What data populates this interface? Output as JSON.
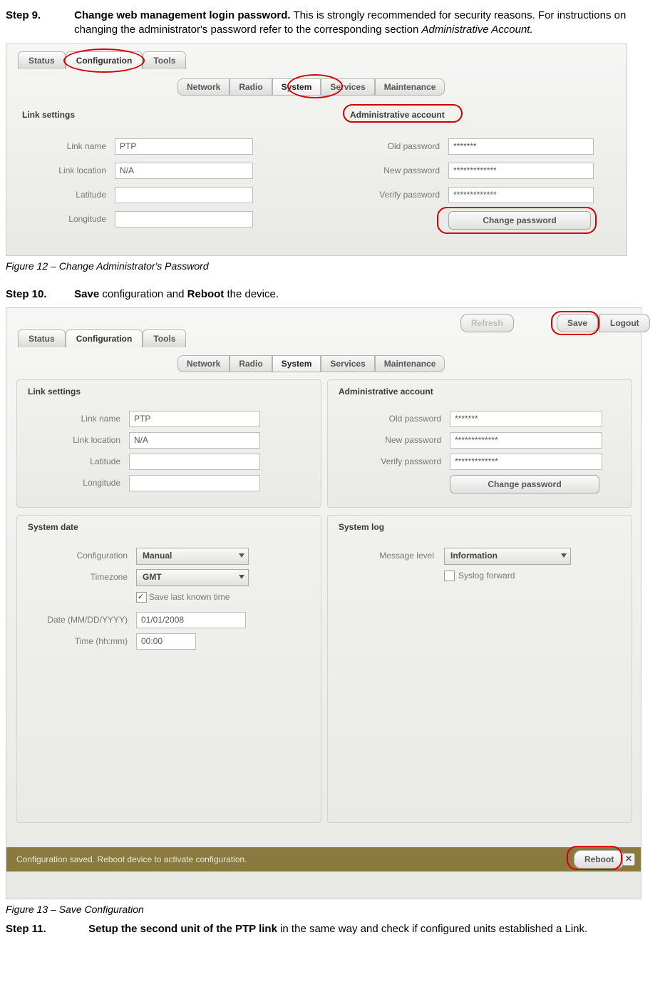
{
  "step9": {
    "label": "Step 9.",
    "title": "Change web management login password.",
    "rest": " This is strongly recommended for security reasons. For instructions on changing the administrator's password refer to the corresponding section ",
    "italic": "Administrative Account."
  },
  "fig12_caption": "Figure 12 – Change Administrator's Password",
  "step10": {
    "label": "Step 10.",
    "save": "Save",
    "mid": " configuration and ",
    "reboot": "Reboot",
    "end": " the device."
  },
  "fig13_caption": "Figure 13 – Save Configuration",
  "step11": {
    "label": "Step 11.",
    "title": "Setup the second unit of the PTP link",
    "rest": " in the same way and check if configured units established a Link."
  },
  "shot1": {
    "tabs": [
      "Status",
      "Configuration",
      "Tools"
    ],
    "subtabs": [
      "Network",
      "Radio",
      "System",
      "Services",
      "Maintenance"
    ],
    "link_settings_title": "Link settings",
    "admin_title": "Administrative account",
    "labels": {
      "link_name": "Link name",
      "link_location": "Link location",
      "latitude": "Latitude",
      "longitude": "Longitude",
      "old_pw": "Old password",
      "new_pw": "New password",
      "verify_pw": "Verify password"
    },
    "values": {
      "link_name": "PTP",
      "link_location": "N/A",
      "latitude": "",
      "longitude": "",
      "old_pw": "*******",
      "new_pw": "*************",
      "verify_pw": "*************"
    },
    "change_pw_btn": "Change password"
  },
  "shot2": {
    "top_buttons": {
      "refresh": "Refresh",
      "save": "Save",
      "logout": "Logout"
    },
    "tabs": [
      "Status",
      "Configuration",
      "Tools"
    ],
    "subtabs": [
      "Network",
      "Radio",
      "System",
      "Services",
      "Maintenance"
    ],
    "link_settings_title": "Link settings",
    "admin_title": "Administrative account",
    "labels": {
      "link_name": "Link name",
      "link_location": "Link location",
      "latitude": "Latitude",
      "longitude": "Longitude",
      "old_pw": "Old password",
      "new_pw": "New password",
      "verify_pw": "Verify password",
      "sysdate": "System date",
      "config": "Configuration",
      "timezone": "Timezone",
      "save_last": "Save last known time",
      "date": "Date (MM/DD/YYYY)",
      "time": "Time (hh:mm)",
      "syslog": "System log",
      "msglvl": "Message level",
      "syslog_fwd": "Syslog forward"
    },
    "values": {
      "link_name": "PTP",
      "link_location": "N/A",
      "latitude": "",
      "longitude": "",
      "old_pw": "*******",
      "new_pw": "*************",
      "verify_pw": "*************",
      "config": "Manual",
      "timezone": "GMT",
      "date": "01/01/2008",
      "time": "00:00",
      "msglvl": "Information"
    },
    "change_pw_btn": "Change password",
    "notice": "Configuration saved. Reboot device to activate configuration.",
    "reboot_btn": "Reboot"
  }
}
